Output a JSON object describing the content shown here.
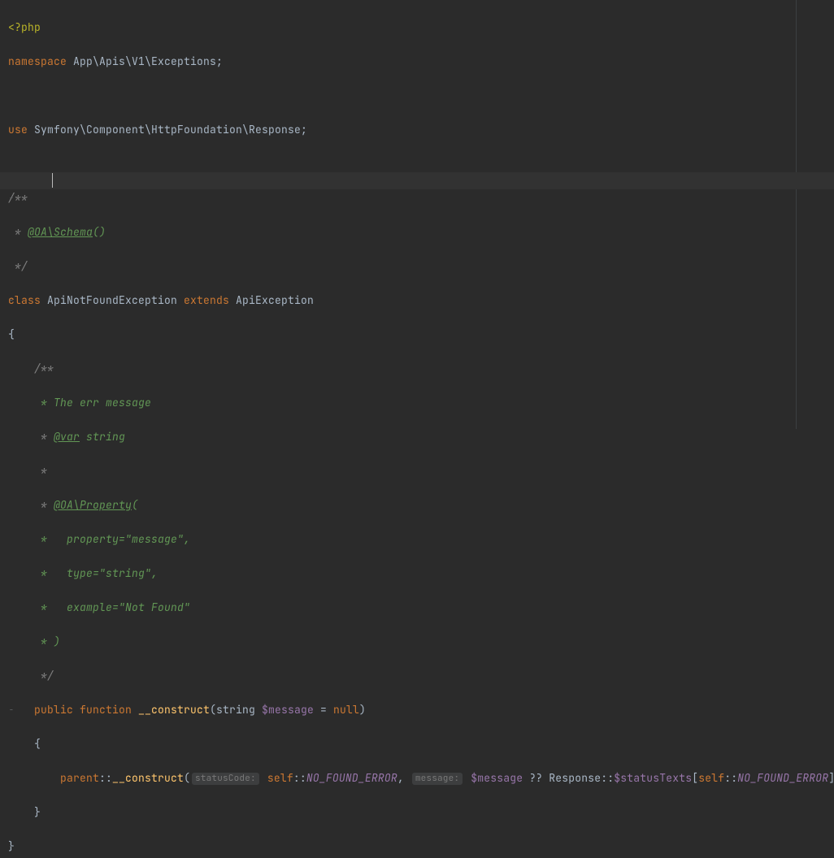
{
  "code": {
    "open_tag": "<?php",
    "ns_kw": "namespace",
    "ns_path": " App\\Apis\\V1\\Exceptions",
    "use_kw": "use",
    "use_path": " Symfony\\Component\\HttpFoundation\\Response",
    "doc_open": "/**",
    "doc_star": " *",
    "doc_star2": " * ",
    "oa_schema": "@OA\\Schema",
    "paren_empty": "()",
    "doc_close": " */",
    "class_kw": "class",
    "class_name": " ApiNotFoundException ",
    "extends_kw": "extends",
    "parent_class": " ApiException",
    "brace_open": "{",
    "brace_close": "}",
    "doc2_l1": "    /**",
    "doc2_l2": "     * The err message",
    "doc2_l3a": "     * ",
    "doc2_var": "@var",
    "doc2_var_t": " string",
    "doc2_star": "     *",
    "doc2_prop": "@OA\\Property",
    "doc2_prop_open": "(",
    "doc2_p1": "     *   property=\"message\",",
    "doc2_p2": "     *   type=\"string\",",
    "doc2_p3": "     *   example=\"Not Found\"",
    "doc2_p4": "     * )",
    "doc2_close": "     */",
    "indent1": "    ",
    "indent2": "        ",
    "public_kw": "public",
    "function_kw": " function ",
    "ctor": "__construct",
    "lparen": "(",
    "str_kw": "string ",
    "msg_var": "$message",
    "eq": " = ",
    "null_kw": "null",
    "rparen": ")",
    "parent_kw": "parent",
    "dcolon": "::",
    "hint1": "statusCode:",
    "self_kw": "self",
    "const1": "NO_FOUND_ERROR",
    "comma": ", ",
    "hint2": "message:",
    "coalesce": " ?? ",
    "resp": "Response",
    "stexts": "$statusTexts",
    "lbr": "[",
    "rbr": "]",
    "semicolon": ";",
    "semi_end": ");"
  }
}
